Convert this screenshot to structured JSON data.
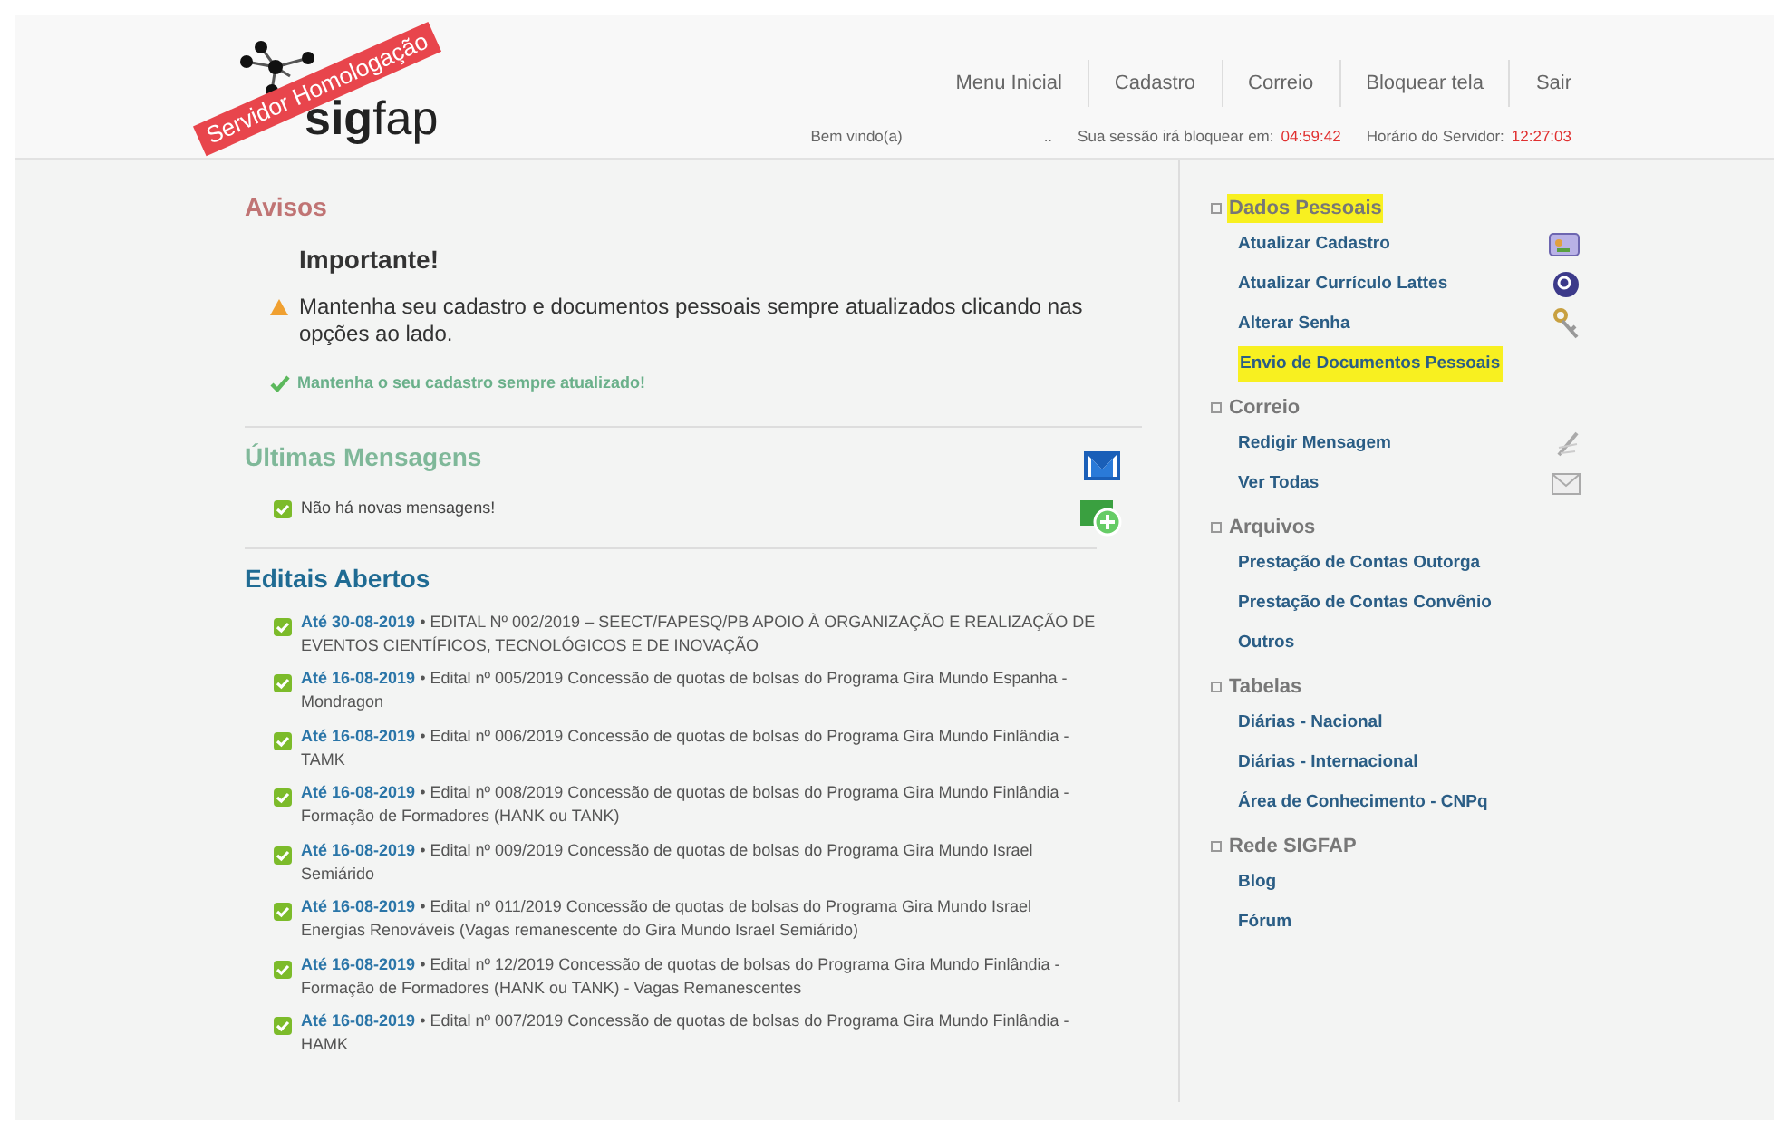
{
  "header": {
    "logo": "**sig**fap",
    "ribbon": "Servidor Homologação",
    "nav": [
      "Menu Inicial",
      "Cadastro",
      "Correio",
      "Bloquear tela",
      "Sair"
    ],
    "welcome": "Bem vindo(a)",
    "welcome_tail": "..",
    "session_label": "Sua sessão irá bloquear em:",
    "session_time": "04:59:42",
    "server_label": "Horário do Servidor:",
    "server_time": "12:27:03"
  },
  "avisos": {
    "title": "Avisos",
    "heading": "Importante!",
    "message": "Mantenha seu cadastro e documentos pessoais sempre atualizados clicando nas opções ao lado.",
    "ok": "Mantenha o seu cadastro sempre atualizado!"
  },
  "mensagens": {
    "title": "Últimas Mensagens",
    "empty": "Não há novas mensagens!"
  },
  "editais": {
    "title": "Editais Abertos",
    "separator": "•",
    "items": [
      {
        "deadline": "Até 30-08-2019",
        "text": "EDITAL Nº 002/2019 – SEECT/FAPESQ/PB APOIO À ORGANIZAÇÃO E REALIZAÇÃO DE EVENTOS CIENTÍFICOS, TECNOLÓGICOS E DE INOVAÇÃO"
      },
      {
        "deadline": "Até 16-08-2019",
        "text": "Edital nº 005/2019 Concessão de quotas de bolsas do Programa Gira Mundo Espanha - Mondragon"
      },
      {
        "deadline": "Até 16-08-2019",
        "text": "Edital nº 006/2019 Concessão de quotas de bolsas do Programa Gira Mundo Finlândia - TAMK"
      },
      {
        "deadline": "Até 16-08-2019",
        "text": "Edital nº 008/2019 Concessão de quotas de bolsas do Programa Gira Mundo Finlândia - Formação de Formadores (HANK ou TANK)"
      },
      {
        "deadline": "Até 16-08-2019",
        "text": "Edital nº 009/2019 Concessão de quotas de bolsas do Programa Gira Mundo Israel Semiárido"
      },
      {
        "deadline": "Até 16-08-2019",
        "text": "Edital nº 011/2019 Concessão de quotas de bolsas do Programa Gira Mundo Israel Energias Renováveis (Vagas remanescente do Gira Mundo Israel Semiárido)"
      },
      {
        "deadline": "Até 16-08-2019",
        "text": "Edital nº 12/2019 Concessão de quotas de bolsas do Programa Gira Mundo Finlândia - Formação de Formadores (HANK ou TANK) - Vagas Remanescentes"
      },
      {
        "deadline": "Até 16-08-2019",
        "text": "Edital nº 007/2019 Concessão de quotas de bolsas do Programa Gira Mundo Finlândia - HAMK"
      }
    ]
  },
  "sidebar": [
    {
      "title": "Dados Pessoais",
      "highlighted": true,
      "items": [
        {
          "label": "Atualizar Cadastro",
          "kind": "card",
          "highlighted": false
        },
        {
          "label": "Atualizar Currículo Lattes",
          "kind": "lattes",
          "highlighted": false
        },
        {
          "label": "Alterar Senha",
          "kind": "keys",
          "highlighted": false
        },
        {
          "label": "Envio de Documentos Pessoais",
          "kind": "plain",
          "highlighted": true
        }
      ]
    },
    {
      "title": "Correio",
      "highlighted": false,
      "items": [
        {
          "label": "Redigir Mensagem",
          "kind": "pen",
          "highlighted": false
        },
        {
          "label": "Ver Todas",
          "kind": "mail",
          "highlighted": false
        }
      ]
    },
    {
      "title": "Arquivos",
      "highlighted": false,
      "items": [
        {
          "label": "Prestação de Contas Outorga",
          "kind": "plain",
          "highlighted": false
        },
        {
          "label": "Prestação de Contas Convênio",
          "kind": "plain",
          "highlighted": false
        },
        {
          "label": "Outros",
          "kind": "plain",
          "highlighted": false
        }
      ]
    },
    {
      "title": "Tabelas",
      "highlighted": false,
      "items": [
        {
          "label": "Diárias - Nacional",
          "kind": "plain",
          "highlighted": false
        },
        {
          "label": "Diárias - Internacional",
          "kind": "plain",
          "highlighted": false
        },
        {
          "label": "Área de Conhecimento - CNPq",
          "kind": "plain",
          "highlighted": false
        }
      ]
    },
    {
      "title": "Rede SIGFAP",
      "highlighted": false,
      "items": [
        {
          "label": "Blog",
          "kind": "plain",
          "highlighted": false
        },
        {
          "label": "Fórum",
          "kind": "plain",
          "highlighted": false
        }
      ]
    }
  ]
}
